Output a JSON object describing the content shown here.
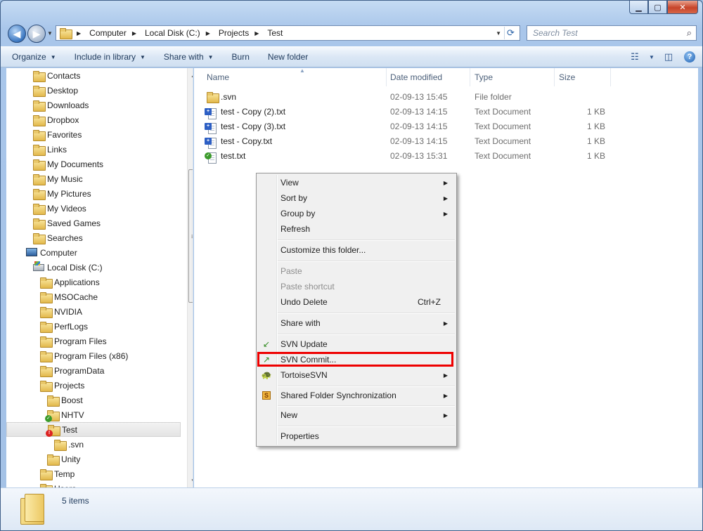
{
  "address": {
    "crumbs": [
      "Computer",
      "Local Disk (C:)",
      "Projects",
      "Test"
    ]
  },
  "search": {
    "placeholder": "Search Test"
  },
  "toolbar": {
    "organize": "Organize",
    "include_in_library": "Include in library",
    "share_with": "Share with",
    "burn": "Burn",
    "new_folder": "New folder"
  },
  "nav_tree": {
    "items": [
      {
        "label": "Contacts",
        "icon": "contacts-folder-icon"
      },
      {
        "label": "Desktop",
        "icon": "desktop-folder-icon"
      },
      {
        "label": "Downloads",
        "icon": "downloads-folder-icon"
      },
      {
        "label": "Dropbox",
        "icon": "dropbox-folder-icon"
      },
      {
        "label": "Favorites",
        "icon": "favorites-folder-icon"
      },
      {
        "label": "Links",
        "icon": "links-folder-icon"
      },
      {
        "label": "My Documents",
        "icon": "documents-folder-icon"
      },
      {
        "label": "My Music",
        "icon": "music-folder-icon"
      },
      {
        "label": "My Pictures",
        "icon": "pictures-folder-icon"
      },
      {
        "label": "My Videos",
        "icon": "videos-folder-icon"
      },
      {
        "label": "Saved Games",
        "icon": "saved-games-folder-icon"
      },
      {
        "label": "Searches",
        "icon": "searches-folder-icon"
      },
      {
        "label": "Computer",
        "icon": "computer-icon"
      },
      {
        "label": "Local Disk (C:)",
        "icon": "local-disk-icon"
      },
      {
        "label": "Applications",
        "icon": "folder-icon"
      },
      {
        "label": "MSOCache",
        "icon": "folder-icon"
      },
      {
        "label": "NVIDIA",
        "icon": "folder-icon"
      },
      {
        "label": "PerfLogs",
        "icon": "folder-icon"
      },
      {
        "label": "Program Files",
        "icon": "folder-icon"
      },
      {
        "label": "Program Files (x86)",
        "icon": "folder-icon"
      },
      {
        "label": "ProgramData",
        "icon": "folder-icon"
      },
      {
        "label": "Projects",
        "icon": "folder-icon"
      },
      {
        "label": "Boost",
        "icon": "folder-icon"
      },
      {
        "label": "NHTV",
        "icon": "svn-ok-folder-icon"
      },
      {
        "label": "Test",
        "icon": "svn-modified-folder-icon"
      },
      {
        "label": ".svn",
        "icon": "folder-icon"
      },
      {
        "label": "Unity",
        "icon": "folder-icon"
      },
      {
        "label": "Temp",
        "icon": "folder-icon"
      },
      {
        "label": "Users",
        "icon": "folder-icon"
      }
    ]
  },
  "columns": {
    "name": "Name",
    "date_modified": "Date modified",
    "type": "Type",
    "size": "Size"
  },
  "files": [
    {
      "name": ".svn",
      "date": "02-09-13 15:45",
      "type": "File folder",
      "size": "",
      "icon": "folder-icon"
    },
    {
      "name": "test - Copy (2).txt",
      "date": "02-09-13 14:15",
      "type": "Text Document",
      "size": "1 KB",
      "icon": "svn-added-file-icon"
    },
    {
      "name": "test - Copy (3).txt",
      "date": "02-09-13 14:15",
      "type": "Text Document",
      "size": "1 KB",
      "icon": "svn-added-file-icon"
    },
    {
      "name": "test - Copy.txt",
      "date": "02-09-13 14:15",
      "type": "Text Document",
      "size": "1 KB",
      "icon": "svn-added-file-icon"
    },
    {
      "name": "test.txt",
      "date": "02-09-13 15:31",
      "type": "Text Document",
      "size": "1 KB",
      "icon": "svn-ok-file-icon"
    }
  ],
  "context_menu": {
    "view": "View",
    "sort_by": "Sort by",
    "group_by": "Group by",
    "refresh": "Refresh",
    "customize": "Customize this folder...",
    "paste": "Paste",
    "paste_shortcut": "Paste shortcut",
    "undo_delete": "Undo Delete",
    "undo_shortcut": "Ctrl+Z",
    "share_with": "Share with",
    "svn_update": "SVN Update",
    "svn_commit": "SVN Commit...",
    "tortoisesvn": "TortoiseSVN",
    "shared_folder_sync": "Shared Folder Synchronization",
    "new": "New",
    "properties": "Properties"
  },
  "details": {
    "count": "5 items"
  },
  "colors": {
    "highlight_border": "#e00000",
    "toolbar_text": "#1e395b"
  }
}
